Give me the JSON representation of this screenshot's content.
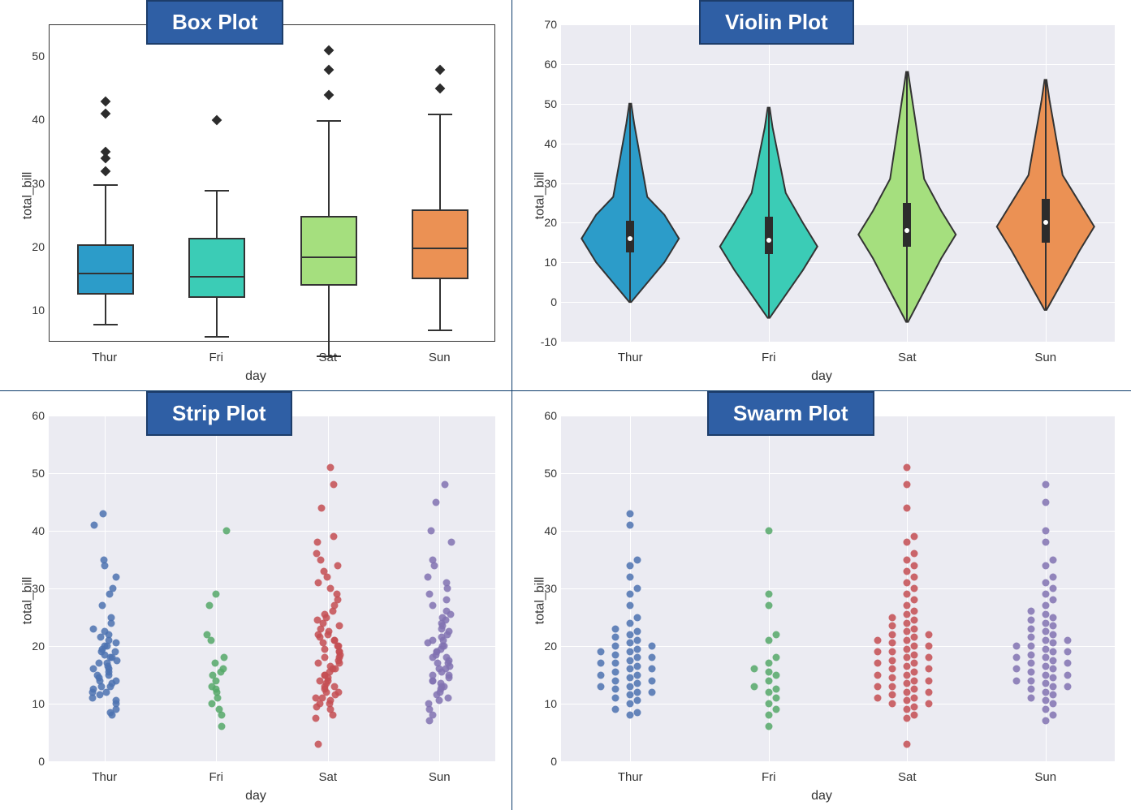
{
  "titles": {
    "box": "Box Plot",
    "violin": "Violin Plot",
    "strip": "Strip Plot",
    "swarm": "Swarm Plot"
  },
  "axes": {
    "xlabel": "day",
    "ylabel": "total_bill",
    "categories": [
      "Thur",
      "Fri",
      "Sat",
      "Sun"
    ]
  },
  "colors": {
    "box": [
      "#2c9cc9",
      "#3bccb6",
      "#a5df7e",
      "#eb9154"
    ],
    "dot": [
      "#4c72b0",
      "#55a868",
      "#c44e52",
      "#8172b2"
    ]
  },
  "chart_data": [
    {
      "type": "box",
      "title": "Box Plot",
      "xlabel": "day",
      "ylabel": "total_bill",
      "ylim": [
        5,
        55
      ],
      "yticks": [
        10,
        20,
        30,
        40,
        50
      ],
      "categories": [
        "Thur",
        "Fri",
        "Sat",
        "Sun"
      ],
      "series": [
        {
          "name": "Thur",
          "min": 8,
          "q1": 12.5,
          "median": 16,
          "q3": 20.5,
          "max": 30,
          "outliers": [
            32,
            34,
            35,
            41,
            43
          ]
        },
        {
          "name": "Fri",
          "min": 6,
          "q1": 12,
          "median": 15.5,
          "q3": 21.5,
          "max": 29,
          "outliers": [
            40
          ]
        },
        {
          "name": "Sat",
          "min": 3,
          "q1": 14,
          "median": 18.5,
          "q3": 25,
          "max": 40,
          "outliers": [
            44,
            48,
            51
          ]
        },
        {
          "name": "Sun",
          "min": 7,
          "q1": 15,
          "median": 20,
          "q3": 26,
          "max": 41,
          "outliers": [
            45,
            48
          ]
        }
      ]
    },
    {
      "type": "violin",
      "title": "Violin Plot",
      "xlabel": "day",
      "ylabel": "total_bill",
      "ylim": [
        -10,
        70
      ],
      "yticks": [
        -10,
        0,
        10,
        20,
        30,
        40,
        50,
        60,
        70
      ],
      "categories": [
        "Thur",
        "Fri",
        "Sat",
        "Sun"
      ],
      "series": [
        {
          "name": "Thur",
          "min": 0,
          "q1": 12.5,
          "median": 16,
          "q3": 20.5,
          "max": 50,
          "widest": 16
        },
        {
          "name": "Fri",
          "min": -4,
          "q1": 12,
          "median": 15.5,
          "q3": 21.5,
          "max": 49,
          "widest": 14
        },
        {
          "name": "Sat",
          "min": -5,
          "q1": 14,
          "median": 18,
          "q3": 25,
          "max": 58,
          "widest": 17
        },
        {
          "name": "Sun",
          "min": -2,
          "q1": 15,
          "median": 20,
          "q3": 26,
          "max": 56,
          "widest": 19
        }
      ]
    },
    {
      "type": "strip",
      "title": "Strip Plot",
      "xlabel": "day",
      "ylabel": "total_bill",
      "ylim": [
        0,
        60
      ],
      "yticks": [
        0,
        10,
        20,
        30,
        40,
        50,
        60
      ],
      "categories": [
        "Thur",
        "Fri",
        "Sat",
        "Sun"
      ],
      "series": [
        {
          "name": "Thur",
          "values": [
            8,
            8.5,
            9,
            10,
            10.5,
            11,
            11.5,
            12,
            12,
            12.5,
            13,
            13,
            13.5,
            14,
            14,
            14.5,
            15,
            15,
            15.5,
            16,
            16,
            16.5,
            17,
            17,
            17.5,
            18,
            18,
            18.5,
            19,
            19,
            19.5,
            20,
            20,
            20.5,
            21,
            21.5,
            22,
            22.5,
            23,
            24,
            25,
            27,
            29,
            30,
            32,
            34,
            35,
            41,
            43
          ]
        },
        {
          "name": "Fri",
          "values": [
            6,
            8,
            9,
            10,
            11,
            12,
            12.5,
            13,
            14,
            15,
            15.5,
            16,
            17,
            18,
            21,
            22,
            27,
            29,
            40
          ]
        },
        {
          "name": "Sat",
          "values": [
            3,
            7.5,
            8,
            9,
            9.5,
            10,
            10,
            10.5,
            11,
            11,
            11.5,
            12,
            12,
            12.5,
            13,
            13,
            13.5,
            14,
            14,
            14.5,
            15,
            15,
            15.5,
            16,
            16,
            16.5,
            17,
            17,
            17.5,
            18,
            18,
            18.5,
            19,
            19,
            19.5,
            20,
            20,
            20.5,
            21,
            21,
            21.5,
            22,
            22,
            22.5,
            23,
            23.5,
            24,
            24.5,
            25,
            25.5,
            26,
            27,
            28,
            29,
            30,
            31,
            32,
            33,
            34,
            35,
            36,
            38,
            39,
            44,
            48,
            51
          ]
        },
        {
          "name": "Sun",
          "values": [
            7,
            8,
            9,
            10,
            10.5,
            11,
            11.5,
            12,
            12.5,
            13,
            13,
            13.5,
            14,
            14,
            14.5,
            15,
            15,
            15.5,
            16,
            16,
            16.5,
            17,
            17,
            17.5,
            18,
            18,
            18.5,
            19,
            19,
            19.5,
            20,
            20,
            20.5,
            21,
            21,
            21.5,
            22,
            22.5,
            23,
            23.5,
            24,
            24.5,
            25,
            25.5,
            26,
            27,
            28,
            29,
            30,
            31,
            32,
            34,
            35,
            38,
            40,
            45,
            48
          ]
        }
      ]
    },
    {
      "type": "swarm",
      "title": "Swarm Plot",
      "xlabel": "day",
      "ylabel": "total_bill",
      "ylim": [
        0,
        60
      ],
      "yticks": [
        0,
        10,
        20,
        30,
        40,
        50,
        60
      ],
      "categories": [
        "Thur",
        "Fri",
        "Sat",
        "Sun"
      ],
      "series": [
        {
          "name": "Thur",
          "values": [
            8,
            8.5,
            9,
            10,
            10.5,
            11,
            11.5,
            12,
            12,
            12.5,
            13,
            13,
            13.5,
            14,
            14,
            14.5,
            15,
            15,
            15.5,
            16,
            16,
            16.5,
            17,
            17,
            17.5,
            18,
            18,
            18.5,
            19,
            19,
            19.5,
            20,
            20,
            20.5,
            21,
            21.5,
            22,
            22.5,
            23,
            24,
            25,
            27,
            29,
            30,
            32,
            34,
            35,
            41,
            43
          ]
        },
        {
          "name": "Fri",
          "values": [
            6,
            8,
            9,
            10,
            11,
            12,
            12.5,
            13,
            14,
            15,
            15.5,
            16,
            17,
            18,
            21,
            22,
            27,
            29,
            40
          ]
        },
        {
          "name": "Sat",
          "values": [
            3,
            7.5,
            8,
            9,
            9.5,
            10,
            10,
            10.5,
            11,
            11,
            11.5,
            12,
            12,
            12.5,
            13,
            13,
            13.5,
            14,
            14,
            14.5,
            15,
            15,
            15.5,
            16,
            16,
            16.5,
            17,
            17,
            17.5,
            18,
            18,
            18.5,
            19,
            19,
            19.5,
            20,
            20,
            20.5,
            21,
            21,
            21.5,
            22,
            22,
            22.5,
            23,
            23.5,
            24,
            24.5,
            25,
            25.5,
            26,
            27,
            28,
            29,
            30,
            31,
            32,
            33,
            34,
            35,
            36,
            38,
            39,
            44,
            48,
            51
          ]
        },
        {
          "name": "Sun",
          "values": [
            7,
            8,
            9,
            10,
            10.5,
            11,
            11.5,
            12,
            12.5,
            13,
            13,
            13.5,
            14,
            14,
            14.5,
            15,
            15,
            15.5,
            16,
            16,
            16.5,
            17,
            17,
            17.5,
            18,
            18,
            18.5,
            19,
            19,
            19.5,
            20,
            20,
            20.5,
            21,
            21,
            21.5,
            22,
            22.5,
            23,
            23.5,
            24,
            24.5,
            25,
            25.5,
            26,
            27,
            28,
            29,
            30,
            31,
            32,
            34,
            35,
            38,
            40,
            45,
            48
          ]
        }
      ]
    }
  ]
}
